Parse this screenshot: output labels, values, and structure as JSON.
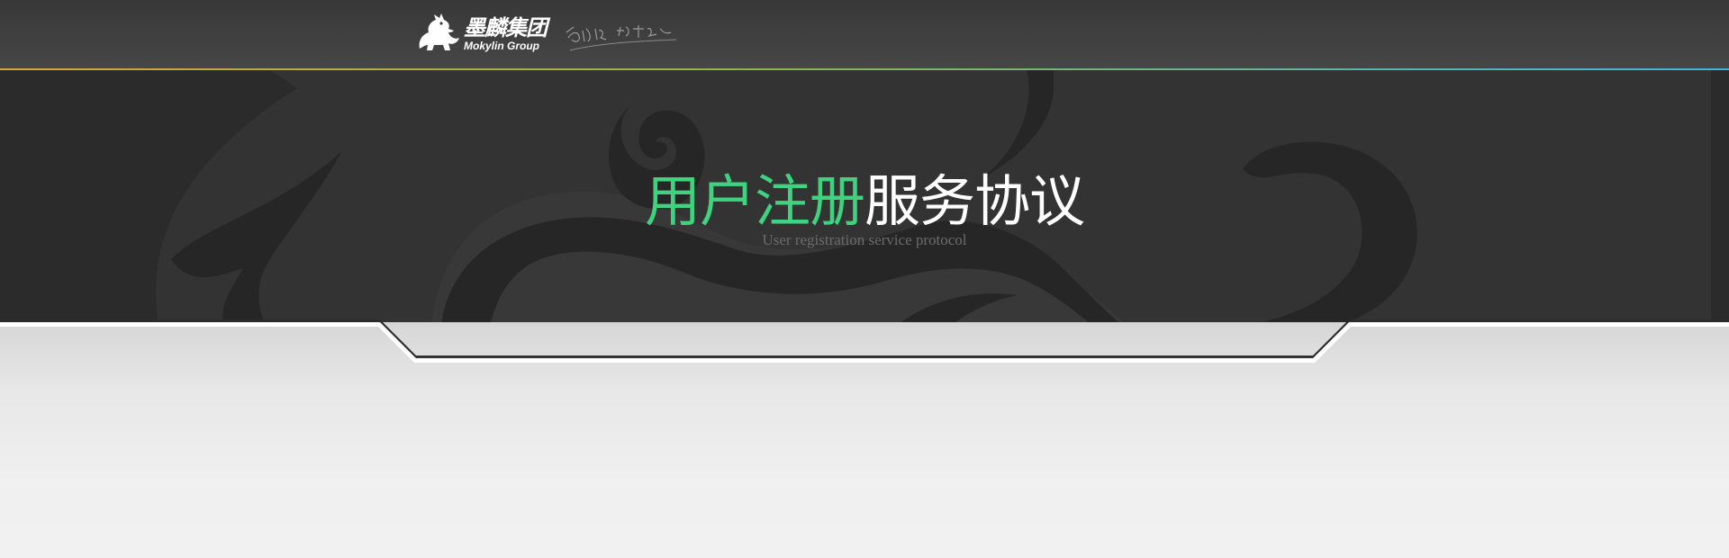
{
  "header": {
    "logo": {
      "name_cn": "墨麟集团",
      "name_en": "Mokylin Group",
      "icon": "qilin-logo-icon",
      "slogan_icon": "handwritten-slogan"
    }
  },
  "banner": {
    "title_accent": "用户注册",
    "title_rest": "服务协议",
    "subtitle": "User registration service protocol"
  },
  "colors": {
    "header_bg": "#464646",
    "banner_bg": "#2b2b2b",
    "accent_green": "#3fd37f",
    "page_bg": "#f0f0f0"
  }
}
